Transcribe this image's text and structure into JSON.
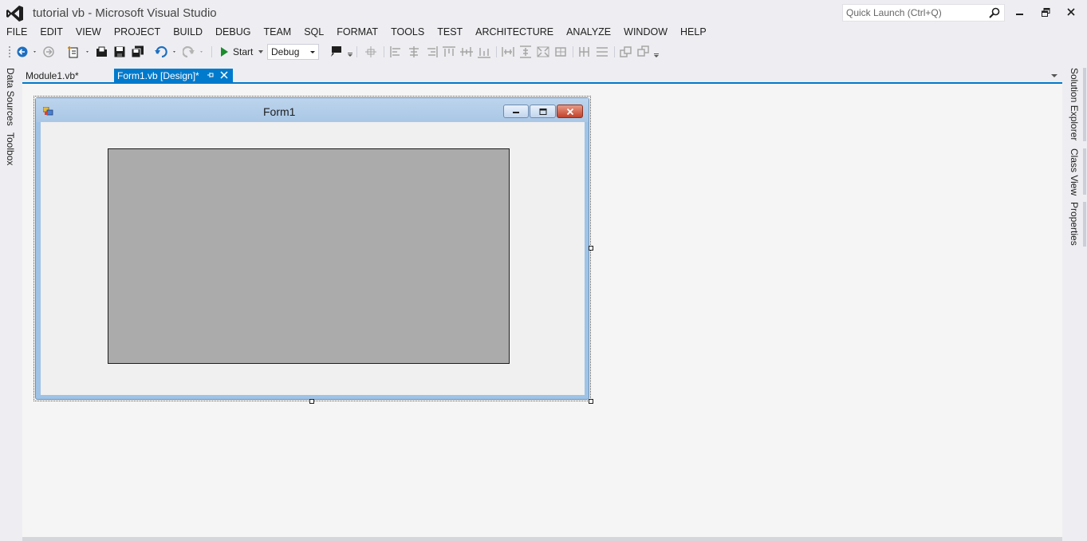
{
  "window": {
    "title": "tutorial vb - Microsoft Visual Studio",
    "quick_launch_placeholder": "Quick Launch (Ctrl+Q)"
  },
  "menu": [
    "FILE",
    "EDIT",
    "VIEW",
    "PROJECT",
    "BUILD",
    "DEBUG",
    "TEAM",
    "SQL",
    "FORMAT",
    "TOOLS",
    "TEST",
    "ARCHITECTURE",
    "ANALYZE",
    "WINDOW",
    "HELP"
  ],
  "toolbar": {
    "start_label": "Start",
    "configuration": "Debug"
  },
  "left_tabs": {
    "data_sources": "Data Sources",
    "toolbox": "Toolbox"
  },
  "right_tabs": {
    "solution_explorer": "Solution Explorer",
    "class_view": "Class View",
    "properties": "Properties"
  },
  "documents": {
    "tab1": "Module1.vb*",
    "tab2": "Form1.vb [Design]*"
  },
  "form": {
    "title": "Form1"
  },
  "colors": {
    "accent": "#007acc",
    "panel": "#ababab",
    "surface": "#f5f5f5"
  }
}
